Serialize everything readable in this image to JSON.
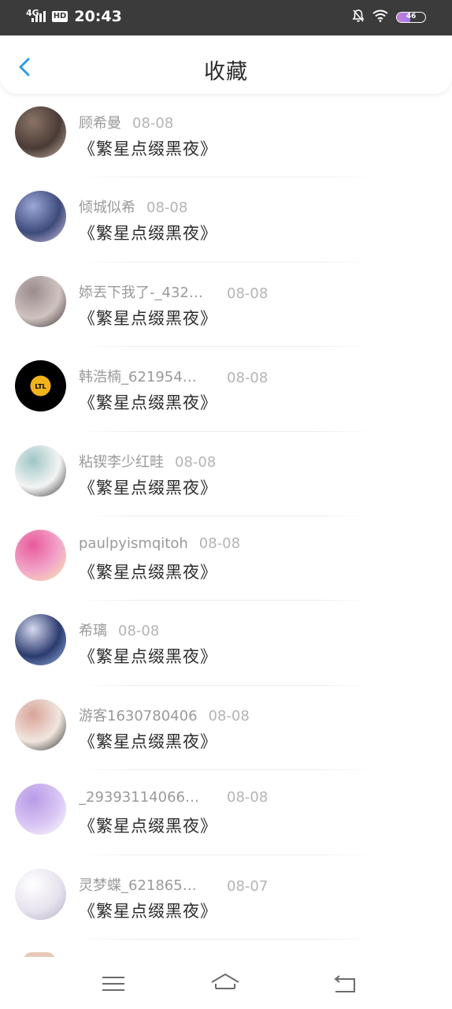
{
  "status_bar": {
    "network": "4G",
    "hd": "HD",
    "time": "20:43",
    "battery": "46",
    "battery_level": 0.46,
    "icons": [
      "signal-icon",
      "mute-bell-icon",
      "wifi-icon",
      "battery-icon"
    ]
  },
  "header": {
    "title": "收藏",
    "back_icon": "chevron-left-icon",
    "accent_color": "#2a9ce8"
  },
  "items": [
    {
      "user": "顾希曼",
      "date": "08-08",
      "work": "《繁星点缀黑夜》",
      "avatar_colors": [
        "#4a3b36",
        "#c7b3a6",
        "#8a7466"
      ]
    },
    {
      "user": "倾城似希",
      "date": "08-08",
      "work": "《繁星点缀黑夜》",
      "avatar_colors": [
        "#3d4b7a",
        "#d7c3e6",
        "#9ba7d8"
      ]
    },
    {
      "user": "婖丟下我了-_432…",
      "date": "08-08",
      "work": "《繁星点缀黑夜》",
      "avatar_colors": [
        "#cfc3bf",
        "#3a2f33",
        "#9a8b8d"
      ]
    },
    {
      "user": "韩浩楠_6219543…",
      "date": "08-08",
      "work": "《繁星点缀黑夜》",
      "avatar_colors": [
        "#000000",
        "#f2b21c",
        "#f2b21c"
      ],
      "avatar_text": "LTL"
    },
    {
      "user": "粘锲李少红畦",
      "date": "08-08",
      "work": "《繁星点缀黑夜》",
      "avatar_colors": [
        "#f4f4f4",
        "#2c2c2c",
        "#9fc6c6"
      ]
    },
    {
      "user": "paulpyismqitoh",
      "date": "08-08",
      "work": "《繁星点缀黑夜》",
      "avatar_colors": [
        "#f2a7c9",
        "#f7e9a8",
        "#e85a9c"
      ]
    },
    {
      "user": "希璃",
      "date": "08-08",
      "work": "《繁星点缀黑夜》",
      "avatar_colors": [
        "#2b3b6e",
        "#9ab6e8",
        "#d5d9f0"
      ]
    },
    {
      "user": "游客1630780406",
      "date": "08-08",
      "work": "《繁星点缀黑夜》",
      "avatar_colors": [
        "#f0e6de",
        "#2a2a2a",
        "#d9a39a"
      ]
    },
    {
      "user": "_293931140662…",
      "date": "08-08",
      "work": "《繁星点缀黑夜》",
      "avatar_colors": [
        "#d9c6f3",
        "#ffffff",
        "#b89be6"
      ]
    },
    {
      "user": "灵梦蝶_6218650…",
      "date": "08-07",
      "work": "《繁星点缀黑夜》",
      "avatar_colors": [
        "#e7e3ee",
        "#b7b0c7",
        "#ffffff"
      ]
    }
  ],
  "nav_bar": {
    "icons": [
      "menu-icon",
      "home-icon",
      "back-nav-icon"
    ]
  }
}
